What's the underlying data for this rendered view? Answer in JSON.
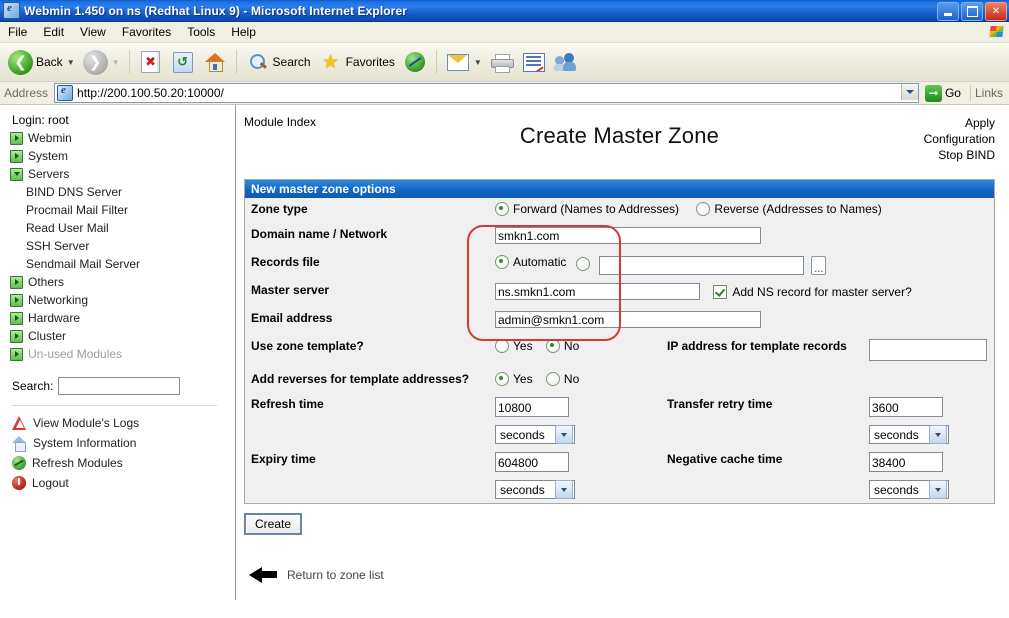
{
  "window": {
    "title": "Webmin 1.450 on ns (Redhat Linux 9) - Microsoft Internet Explorer",
    "minimize_label": "Minimize",
    "restore_label": "Restore",
    "close_label": "✕"
  },
  "menubar": {
    "items": [
      "File",
      "Edit",
      "View",
      "Favorites",
      "Tools",
      "Help"
    ]
  },
  "toolbar": {
    "back_label": "Back",
    "search_label": "Search",
    "favorites_label": "Favorites"
  },
  "address": {
    "label": "Address",
    "url": "http://200.100.50.20:10000/",
    "go_label": "Go",
    "links_label": "Links"
  },
  "sidebar": {
    "login_line": "Login: root",
    "items": [
      {
        "label": "Webmin",
        "state": "collapsed"
      },
      {
        "label": "System",
        "state": "collapsed"
      },
      {
        "label": "Servers",
        "state": "expanded"
      },
      {
        "label": "Others",
        "state": "collapsed"
      },
      {
        "label": "Networking",
        "state": "collapsed"
      },
      {
        "label": "Hardware",
        "state": "collapsed"
      },
      {
        "label": "Cluster",
        "state": "collapsed"
      },
      {
        "label": "Un-used Modules",
        "state": "collapsed",
        "muted": true
      }
    ],
    "servers_children": [
      "BIND DNS Server",
      "Procmail Mail Filter",
      "Read User Mail",
      "SSH Server",
      "Sendmail Mail Server"
    ],
    "search_label": "Search:",
    "search_value": "",
    "actions": [
      {
        "label": "View Module's Logs",
        "icon": "warning-icon"
      },
      {
        "label": "System Information",
        "icon": "house-icon"
      },
      {
        "label": "Refresh Modules",
        "icon": "refresh-icon"
      },
      {
        "label": "Logout",
        "icon": "power-icon"
      }
    ]
  },
  "main": {
    "module_index": "Module Index",
    "title": "Create Master Zone",
    "right_links": [
      "Apply",
      "Configuration",
      "Stop BIND"
    ],
    "panel_title": "New master zone options",
    "fields": {
      "zone_type": {
        "label": "Zone type",
        "options": [
          "Forward (Names to Addresses)",
          "Reverse (Addresses to Names)"
        ],
        "selected": 0
      },
      "domain_name": {
        "label": "Domain name / Network",
        "value": "smkn1.com"
      },
      "records_file": {
        "label": "Records file",
        "auto_label": "Automatic",
        "selected": 0,
        "value": "",
        "browse_label": "..."
      },
      "master_server": {
        "label": "Master server",
        "value": "ns.smkn1.com",
        "checkbox_label": "Add NS record for master server?",
        "checkbox_checked": true
      },
      "email_address": {
        "label": "Email address",
        "value": "admin@smkn1.com"
      },
      "use_zone_template": {
        "label": "Use zone template?",
        "options": [
          "Yes",
          "No"
        ],
        "selected": 1
      },
      "ip_for_template": {
        "label": "IP address for template records",
        "value": ""
      },
      "add_reverses": {
        "label": "Add reverses for template addresses?",
        "options": [
          "Yes",
          "No"
        ],
        "selected": 0
      },
      "refresh_time": {
        "label": "Refresh time",
        "value": "10800",
        "unit": "seconds"
      },
      "transfer_retry_time": {
        "label": "Transfer retry time",
        "value": "3600",
        "unit": "seconds"
      },
      "expiry_time": {
        "label": "Expiry time",
        "value": "604800",
        "unit": "seconds"
      },
      "negative_cache_time": {
        "label": "Negative cache time",
        "value": "38400",
        "unit": "seconds"
      }
    },
    "create_button": "Create",
    "return_link": "Return to zone list"
  },
  "colors": {
    "titlebar_blue": "#1559c8",
    "panel_header_blue": "#1267c4",
    "annotation_red": "#d33a33",
    "nav_icon_green": "#5fbf4a"
  }
}
